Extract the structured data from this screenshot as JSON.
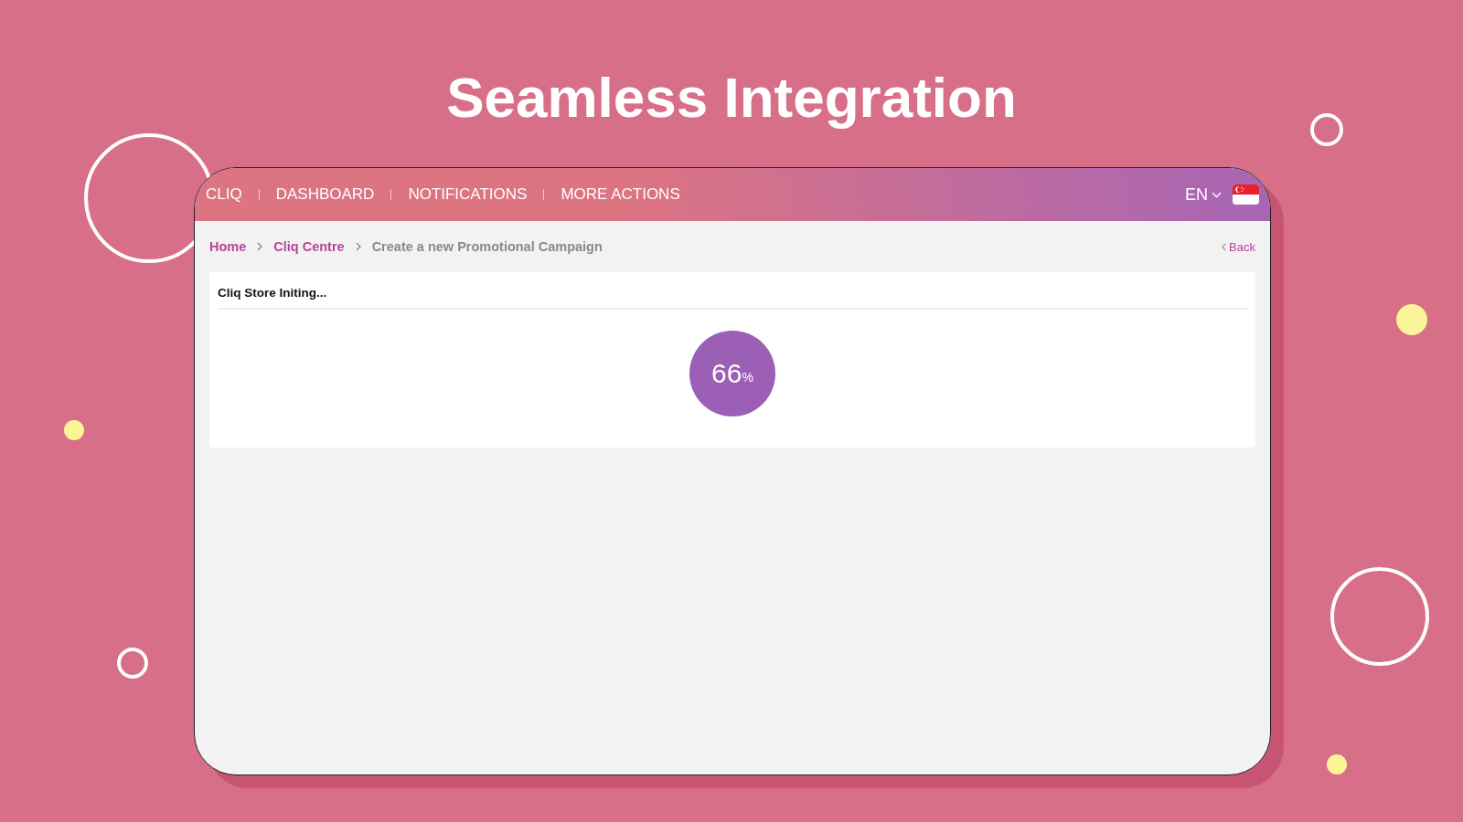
{
  "headline": "Seamless Integration",
  "nav": {
    "brand": "CLIQ",
    "items": [
      {
        "label": "DASHBOARD"
      },
      {
        "label": "NOTIFICATIONS"
      },
      {
        "label": "MORE ACTIONS"
      }
    ],
    "language": "EN"
  },
  "breadcrumb": {
    "items": [
      {
        "label": "Home",
        "kind": "link"
      },
      {
        "label": "Cliq Centre",
        "kind": "link"
      },
      {
        "label": "Create a new Promotional Campaign",
        "kind": "current"
      }
    ],
    "back": "Back"
  },
  "card": {
    "title": "Cliq Store Initing...",
    "progress": {
      "value": "66",
      "unit": "%"
    }
  }
}
